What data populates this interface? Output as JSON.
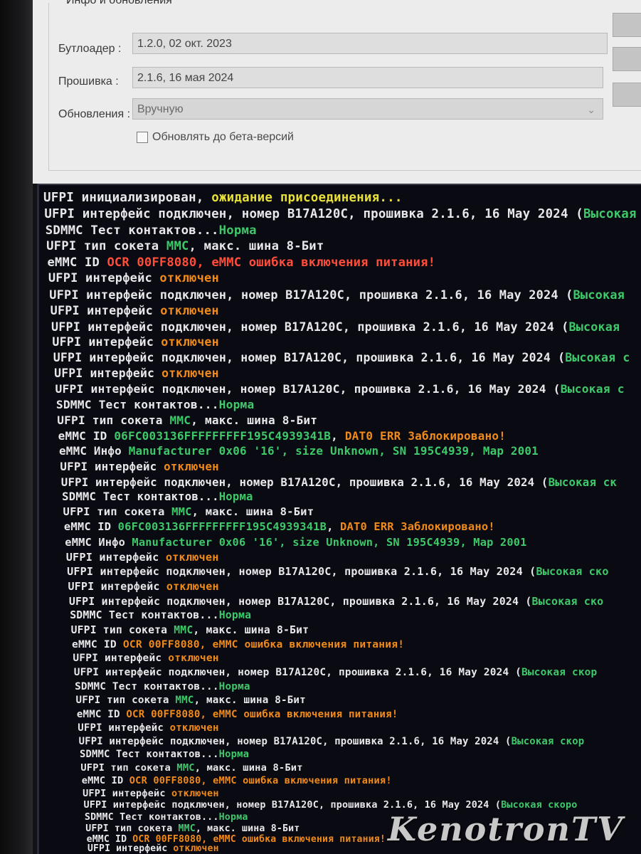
{
  "info_panel": {
    "title": "Инфо и обновления",
    "bootloader_label": "Бутлоадер :",
    "bootloader_value": "1.2.0, 02 окт. 2023",
    "firmware_label": "Прошивка :",
    "firmware_value": "2.1.6, 16 мая 2024",
    "updates_label": "Обновления :",
    "updates_value": "Вручную",
    "beta_checkbox_label": "Обновлять до бета-версий",
    "beta_checked": false
  },
  "colors": {
    "white": "#e8e8ea",
    "yellow": "#e8e03a",
    "green": "#3ec86a",
    "orange": "#f08a1a",
    "red": "#ff4d3a"
  },
  "log": [
    [
      [
        "UFPI инициализирован, ",
        "white"
      ],
      [
        "ожидание присоединения...",
        "yellow"
      ]
    ],
    [
      [
        "UFPI интерфейс подключен, номер B17A120C, прошивка 2.1.6, 16 May 2024 (",
        "white"
      ],
      [
        "Высокая",
        "green"
      ]
    ],
    [
      [
        "SDMMC Тест контактов...",
        "white"
      ],
      [
        "Норма",
        "green"
      ]
    ],
    [
      [
        "UFPI тип сокета ",
        "white"
      ],
      [
        "MMC",
        "green"
      ],
      [
        ", макс. шина 8-Бит",
        "white"
      ]
    ],
    [
      [
        "eMMC ID ",
        "white"
      ],
      [
        "OCR 00FF8080, eMMC ошибка включения питания!",
        "red"
      ]
    ],
    [
      [
        "UFPI интерфейс ",
        "white"
      ],
      [
        "отключен",
        "orange"
      ]
    ],
    [
      [
        "UFPI интерфейс подключен, номер B17A120C, прошивка 2.1.6, 16 May 2024 (",
        "white"
      ],
      [
        "Высокая",
        "green"
      ]
    ],
    [
      [
        "UFPI интерфейс ",
        "white"
      ],
      [
        "отключен",
        "orange"
      ]
    ],
    [
      [
        "UFPI интерфейс подключен, номер B17A120C, прошивка 2.1.6, 16 May 2024 (",
        "white"
      ],
      [
        "Высокая",
        "green"
      ]
    ],
    [
      [
        "UFPI интерфейс ",
        "white"
      ],
      [
        "отключен",
        "orange"
      ]
    ],
    [
      [
        "UFPI интерфейс подключен, номер B17A120C, прошивка 2.1.6, 16 May 2024 (",
        "white"
      ],
      [
        "Высокая с",
        "green"
      ]
    ],
    [
      [
        "UFPI интерфейс ",
        "white"
      ],
      [
        "отключен",
        "orange"
      ]
    ],
    [
      [
        "UFPI интерфейс подключен, номер B17A120C, прошивка 2.1.6, 16 May 2024 (",
        "white"
      ],
      [
        "Высокая с",
        "green"
      ]
    ],
    [
      [
        "SDMMC Тест контактов...",
        "white"
      ],
      [
        "Норма",
        "green"
      ]
    ],
    [
      [
        "UFPI тип сокета ",
        "white"
      ],
      [
        "MMC",
        "green"
      ],
      [
        ", макс. шина 8-Бит",
        "white"
      ]
    ],
    [
      [
        "eMMC ID ",
        "white"
      ],
      [
        "06FC003136FFFFFFFFF195C4939341B",
        "green"
      ],
      [
        ", ",
        "white"
      ],
      [
        "DAT0 ERR Заблокировано!",
        "orange"
      ]
    ],
    [
      [
        "eMMC Инфо ",
        "white"
      ],
      [
        "Manufacturer 0x06 '16', size Unknown, SN 195C4939, Map 2001",
        "green"
      ]
    ],
    [
      [
        "UFPI интерфейс ",
        "white"
      ],
      [
        "отключен",
        "orange"
      ]
    ],
    [
      [
        "UFPI интерфейс подключен, номер B17A120C, прошивка 2.1.6, 16 May 2024 (",
        "white"
      ],
      [
        "Высокая ск",
        "green"
      ]
    ],
    [
      [
        "SDMMC Тест контактов...",
        "white"
      ],
      [
        "Норма",
        "green"
      ]
    ],
    [
      [
        "UFPI тип сокета ",
        "white"
      ],
      [
        "MMC",
        "green"
      ],
      [
        ", макс. шина 8-Бит",
        "white"
      ]
    ],
    [
      [
        "eMMC ID ",
        "white"
      ],
      [
        "06FC003136FFFFFFFFF195C4939341B",
        "green"
      ],
      [
        ", ",
        "white"
      ],
      [
        "DAT0 ERR Заблокировано!",
        "orange"
      ]
    ],
    [
      [
        "eMMC Инфо ",
        "white"
      ],
      [
        "Manufacturer 0x06 '16', size Unknown, SN 195C4939, Map 2001",
        "green"
      ]
    ],
    [
      [
        "UFPI интерфейс ",
        "white"
      ],
      [
        "отключен",
        "orange"
      ]
    ],
    [
      [
        "UFPI интерфейс подключен, номер B17A120C, прошивка 2.1.6, 16 May 2024 (",
        "white"
      ],
      [
        "Высокая ско",
        "green"
      ]
    ],
    [
      [
        "UFPI интерфейс ",
        "white"
      ],
      [
        "отключен",
        "orange"
      ]
    ],
    [
      [
        "UFPI интерфейс подключен, номер B17A120C, прошивка 2.1.6, 16 May 2024 (",
        "white"
      ],
      [
        "Высокая ско",
        "green"
      ]
    ],
    [
      [
        "SDMMC Тест контактов...",
        "white"
      ],
      [
        "Норма",
        "green"
      ]
    ],
    [
      [
        "UFPI тип сокета ",
        "white"
      ],
      [
        "MMC",
        "green"
      ],
      [
        ", макс. шина 8-Бит",
        "white"
      ]
    ],
    [
      [
        "eMMC ID ",
        "white"
      ],
      [
        "OCR 00FF8080, eMMC ошибка включения питания!",
        "orange"
      ]
    ],
    [
      [
        "UFPI интерфейс ",
        "white"
      ],
      [
        "отключен",
        "orange"
      ]
    ],
    [
      [
        "UFPI интерфейс подключен, номер B17A120C, прошивка 2.1.6, 16 May 2024 (",
        "white"
      ],
      [
        "Высокая скор",
        "green"
      ]
    ],
    [
      [
        "SDMMC Тест контактов...",
        "white"
      ],
      [
        "Норма",
        "green"
      ]
    ],
    [
      [
        "UFPI тип сокета ",
        "white"
      ],
      [
        "MMC",
        "green"
      ],
      [
        ", макс. шина 8-Бит",
        "white"
      ]
    ],
    [
      [
        "eMMC ID ",
        "white"
      ],
      [
        "OCR 00FF8080, eMMC ошибка включения питания!",
        "orange"
      ]
    ],
    [
      [
        "UFPI интерфейс ",
        "white"
      ],
      [
        "отключен",
        "orange"
      ]
    ],
    [
      [
        "UFPI интерфейс подключен, номер B17A120C, прошивка 2.1.6, 16 May 2024 (",
        "white"
      ],
      [
        "Высокая скор",
        "green"
      ]
    ],
    [
      [
        "SDMMC Тест контактов...",
        "white"
      ],
      [
        "Норма",
        "green"
      ]
    ],
    [
      [
        "UFPI тип сокета ",
        "white"
      ],
      [
        "MMC",
        "green"
      ],
      [
        ", макс. шина 8-Бит",
        "white"
      ]
    ],
    [
      [
        "eMMC ID ",
        "white"
      ],
      [
        "OCR 00FF8080, eMMC ошибка включения питания!",
        "orange"
      ]
    ],
    [
      [
        "UFPI интерфейс ",
        "white"
      ],
      [
        "отключен",
        "orange"
      ]
    ],
    [
      [
        "UFPI интерфейс подключен, номер B17A120C, прошивка 2.1.6, 16 May 2024 (",
        "white"
      ],
      [
        "Высокая скоро",
        "green"
      ]
    ],
    [
      [
        "SDMMC Тест контактов...",
        "white"
      ],
      [
        "Норма",
        "green"
      ]
    ],
    [
      [
        "UFPI тип сокета ",
        "white"
      ],
      [
        "MMC",
        "green"
      ],
      [
        ", макс. шина 8-Бит",
        "white"
      ]
    ],
    [
      [
        "eMMC ID ",
        "white"
      ],
      [
        "OCR 00FF8080, eMMC ошибка включения питания!",
        "orange"
      ]
    ],
    [
      [
        "UFPI интерфейс ",
        "white"
      ],
      [
        "отключен",
        "orange"
      ]
    ]
  ],
  "watermark": "KenotronTV"
}
